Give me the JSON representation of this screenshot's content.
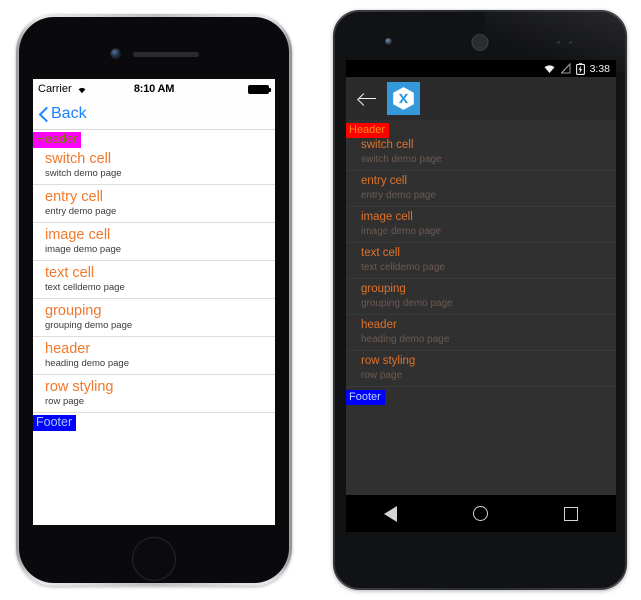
{
  "ios": {
    "status_bar": {
      "carrier": "Carrier",
      "wifi_icon": "wifi-icon",
      "time": "8:10 AM",
      "battery_icon": "battery-full-icon"
    },
    "nav": {
      "back_label": "Back",
      "back_icon": "chevron-left-icon"
    },
    "list": {
      "header": "Header",
      "footer": "Footer",
      "header_bg": "#ff00ff",
      "header_fg": "#808000",
      "footer_bg": "#0000ff",
      "footer_fg": "#a6c8ff",
      "title_color": "#f0792c",
      "items": [
        {
          "title": "switch cell",
          "detail": "switch demo page"
        },
        {
          "title": "entry cell",
          "detail": "entry demo page"
        },
        {
          "title": "image cell",
          "detail": "image demo page"
        },
        {
          "title": "text cell",
          "detail": "text celldemo page"
        },
        {
          "title": "grouping",
          "detail": "grouping demo page"
        },
        {
          "title": "header",
          "detail": "heading demo page"
        },
        {
          "title": "row styling",
          "detail": "row page"
        }
      ]
    }
  },
  "android": {
    "status_bar": {
      "wifi_icon": "wifi-icon",
      "signal_icon": "signal-off-icon",
      "battery_icon": "battery-charging-icon",
      "time": "3:38"
    },
    "action_bar": {
      "back_icon": "arrow-left-icon",
      "logo_icon": "xamarin-logo-icon",
      "logo_color": "#3498db"
    },
    "list": {
      "header": "Header",
      "footer": "Footer",
      "header_bg": "#ff0000",
      "header_fg": "#ff8c1a",
      "footer_bg": "#0000ff",
      "footer_fg": "#c0d4ff",
      "title_color": "#e0722a",
      "items": [
        {
          "title": "switch cell",
          "detail": "switch demo page"
        },
        {
          "title": "entry cell",
          "detail": "entry demo page"
        },
        {
          "title": "image cell",
          "detail": "image demo page"
        },
        {
          "title": "text cell",
          "detail": "text celldemo page"
        },
        {
          "title": "grouping",
          "detail": "grouping demo page"
        },
        {
          "title": "header",
          "detail": "heading demo page"
        },
        {
          "title": "row styling",
          "detail": "row page"
        }
      ]
    },
    "nav_bar": {
      "back_icon": "nav-back-triangle-icon",
      "home_icon": "nav-home-circle-icon",
      "recents_icon": "nav-recents-square-icon"
    }
  }
}
